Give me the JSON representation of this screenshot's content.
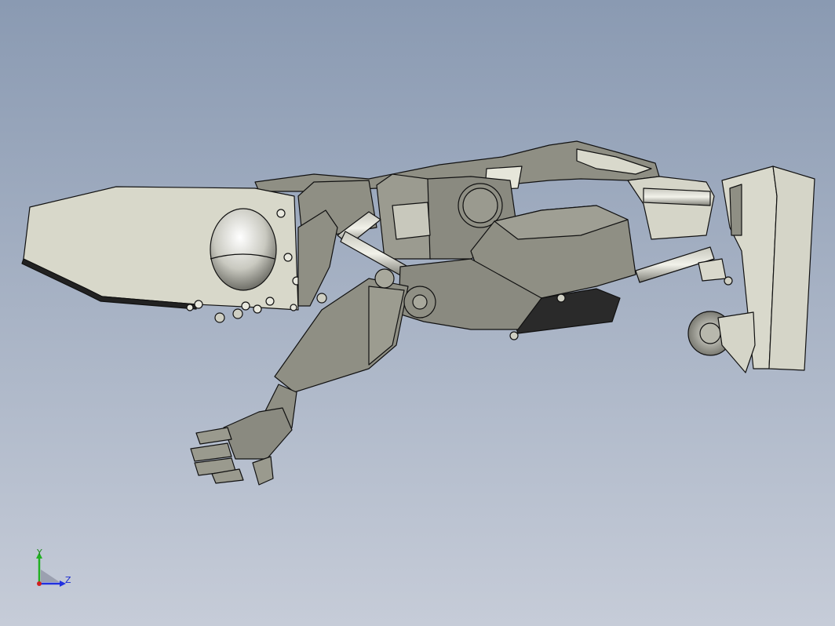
{
  "viewport": {
    "background_top": "#8b9bb3",
    "background_bottom": "#c4cbd8"
  },
  "model": {
    "body_color": "#8f8f84",
    "light_color": "#d9d9cc",
    "dark_color": "#5a5a52",
    "edge_color": "#111111"
  },
  "triad": {
    "y_label": "Y",
    "z_label": "Z",
    "y_color": "#22b022",
    "z_color": "#2030e0",
    "x_color": "#d02020"
  }
}
